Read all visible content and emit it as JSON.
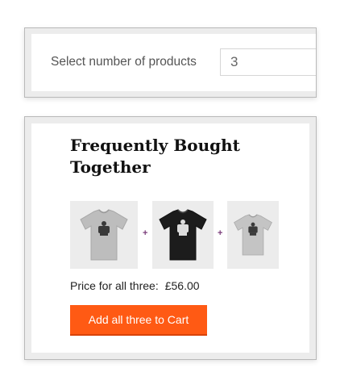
{
  "product_count": {
    "label": "Select number of products",
    "value": "3"
  },
  "fbt": {
    "title": "Frequently Bought Together",
    "products": [
      {
        "icon": "grey-tshirt-icon",
        "color": "#bcbcbc"
      },
      {
        "icon": "black-tshirt-icon",
        "color": "#1a1a1a"
      },
      {
        "icon": "grey-tshirt-icon",
        "color": "#bcbcbc"
      }
    ],
    "separator": "+",
    "price_label": "Price for all three:",
    "price_value": "£56.00",
    "add_button_label": "Add all three to Cart",
    "button_color": "#ff5a14"
  }
}
